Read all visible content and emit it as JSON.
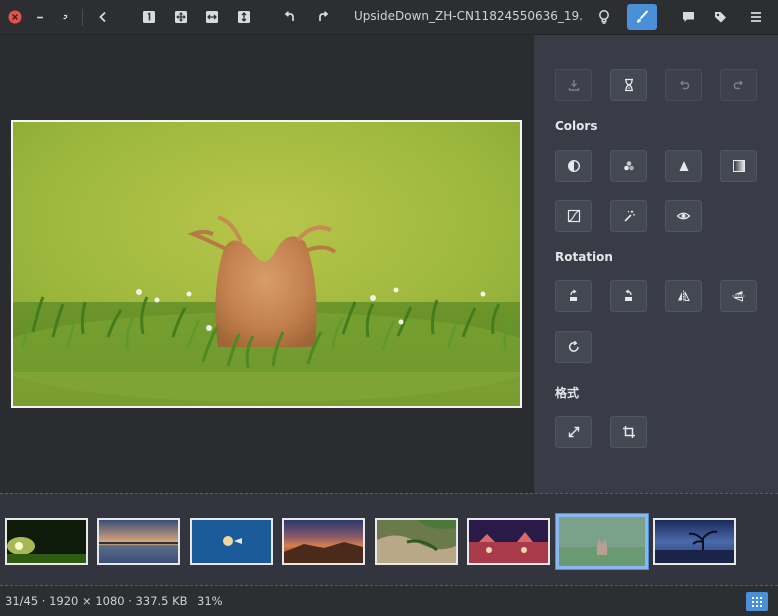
{
  "window": {
    "title": "UpsideDown_ZH-CN11824550636_19..."
  },
  "toolbar": {
    "left_icons": [
      "close-icon",
      "minimize-icon",
      "restore-icon",
      "back-icon",
      "actual-size-icon",
      "fit-icon",
      "fit-width-icon",
      "fit-height-icon",
      "rotate-left-icon",
      "rotate-right-icon"
    ],
    "right_icons": [
      "bulb-icon",
      "brush-icon",
      "comment-icon",
      "tag-icon",
      "menu-icon"
    ],
    "accent": "#4a90d9"
  },
  "panel": {
    "sections": {
      "colors": "Colors",
      "rotation": "Rotation",
      "format": "格式"
    }
  },
  "status": {
    "info": "31/45 · 1920 × 1080 · 337.5 KB",
    "zoom": "31%"
  },
  "filmstrip": {
    "count": 8,
    "selected_index": 6
  }
}
